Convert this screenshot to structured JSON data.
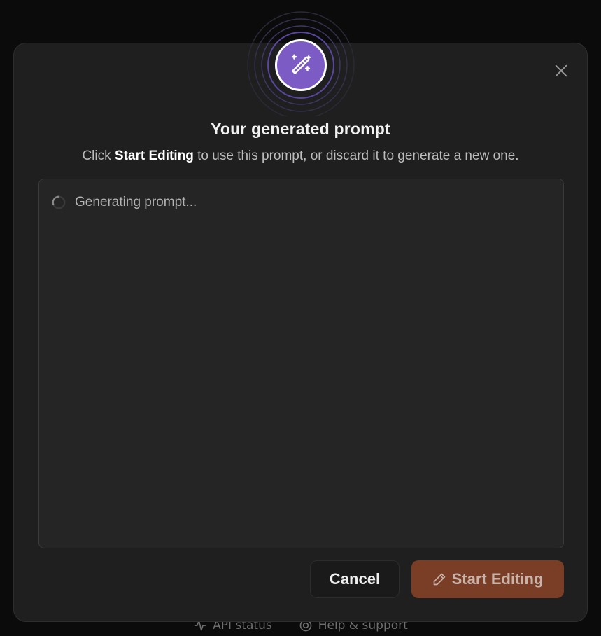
{
  "footer": {
    "api_status": "API status",
    "help_support": "Help & support"
  },
  "dialog": {
    "title": "Your generated prompt",
    "subtitle_prefix": "Click ",
    "subtitle_bold": "Start Editing",
    "subtitle_suffix": " to use this prompt, or discard it to generate a new one.",
    "loading_text": "Generating prompt...",
    "cancel_label": "Cancel",
    "start_label": "Start Editing"
  },
  "icons": {
    "badge": "magic-wand-icon",
    "close": "close-icon",
    "spinner": "loading-spinner-icon",
    "start": "pencil-icon",
    "api_status": "activity-icon",
    "help": "lifebuoy-icon"
  },
  "colors": {
    "badge_fill": "#7c5cc4",
    "primary_button": "#7a3d26",
    "dialog_bg": "#1f1f1f"
  }
}
